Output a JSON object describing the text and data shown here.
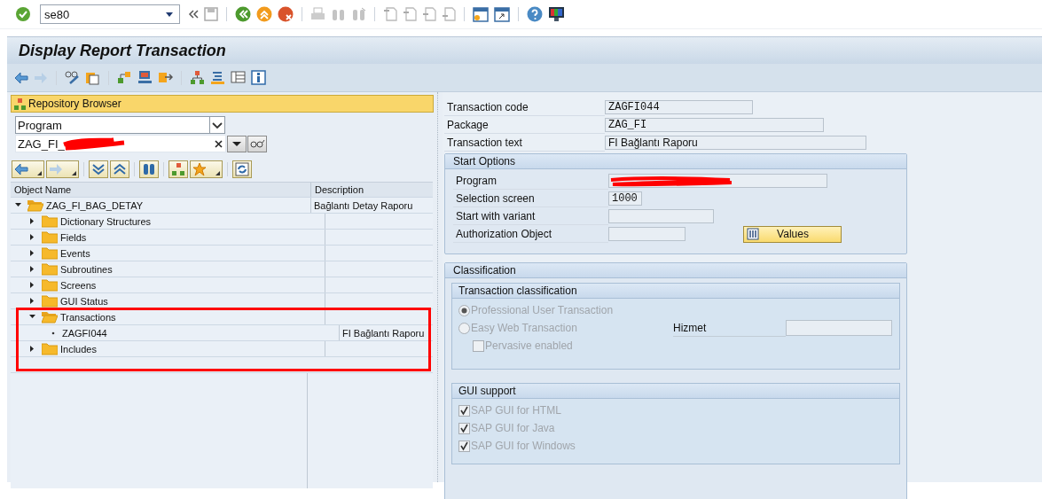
{
  "system_toolbar": {
    "command": "se80"
  },
  "title": "Display Report Transaction",
  "repository_browser": {
    "title": "Repository Browser",
    "object_type": "Program",
    "object_name": "ZAG_FI_",
    "object_name_redacted": true,
    "columns": [
      "Object Name",
      "Description"
    ],
    "tree": [
      {
        "name": "ZAG_FI_BAG_DETAY",
        "description": "Bağlantı Detay Raporu",
        "kind": "open_folder",
        "expanded": true,
        "children": [
          {
            "name": "Dictionary Structures",
            "kind": "folder",
            "expanded": false
          },
          {
            "name": "Fields",
            "kind": "folder",
            "expanded": false
          },
          {
            "name": "Events",
            "kind": "folder",
            "expanded": false
          },
          {
            "name": "Subroutines",
            "kind": "folder",
            "expanded": false
          },
          {
            "name": "Screens",
            "kind": "folder",
            "expanded": false
          },
          {
            "name": "GUI Status",
            "kind": "folder",
            "expanded": false
          },
          {
            "name": "Transactions",
            "kind": "open_folder",
            "expanded": true,
            "highlighted": true,
            "children": [
              {
                "name": "ZAGFI044",
                "description": "FI Bağlantı Raporu",
                "kind": "leaf",
                "highlighted": true
              }
            ]
          },
          {
            "name": "Includes",
            "kind": "folder",
            "expanded": false,
            "highlighted": true
          }
        ]
      }
    ]
  },
  "header_fields": [
    {
      "label": "Transaction code",
      "value": "ZAGFI044",
      "kind": "code"
    },
    {
      "label": "Package",
      "value": "ZAG_FI",
      "kind": "code"
    },
    {
      "label": "Transaction text",
      "value": "FI Bağlantı Raporu",
      "kind": "text"
    }
  ],
  "start_options": {
    "title": "Start Options",
    "fields": [
      {
        "label": "Program",
        "kind": "code",
        "redacted": true
      },
      {
        "label": "Selection screen",
        "value": "1000",
        "kind": "code"
      },
      {
        "label": "Start with variant",
        "kind": "code"
      },
      {
        "label": "Authorization Object",
        "kind": "code"
      }
    ],
    "values_button": "Values"
  },
  "classification": {
    "title": "Classification",
    "transaction_classification": {
      "title": "Transaction classification",
      "options": [
        {
          "label": "Professional User Transaction",
          "selected": true,
          "disabled": true
        },
        {
          "label": "Easy Web Transaction",
          "selected": false,
          "disabled": true
        }
      ],
      "pervasive": {
        "label": "Pervasive enabled",
        "checked": false,
        "disabled": true
      },
      "service_label": "Hizmet"
    },
    "gui_support": {
      "title": "GUI support",
      "options": [
        {
          "label": "SAP GUI for HTML",
          "checked": true,
          "disabled": true
        },
        {
          "label": "SAP GUI for Java",
          "checked": true,
          "disabled": true
        },
        {
          "label": "SAP GUI for Windows",
          "checked": true,
          "disabled": true
        }
      ]
    }
  }
}
